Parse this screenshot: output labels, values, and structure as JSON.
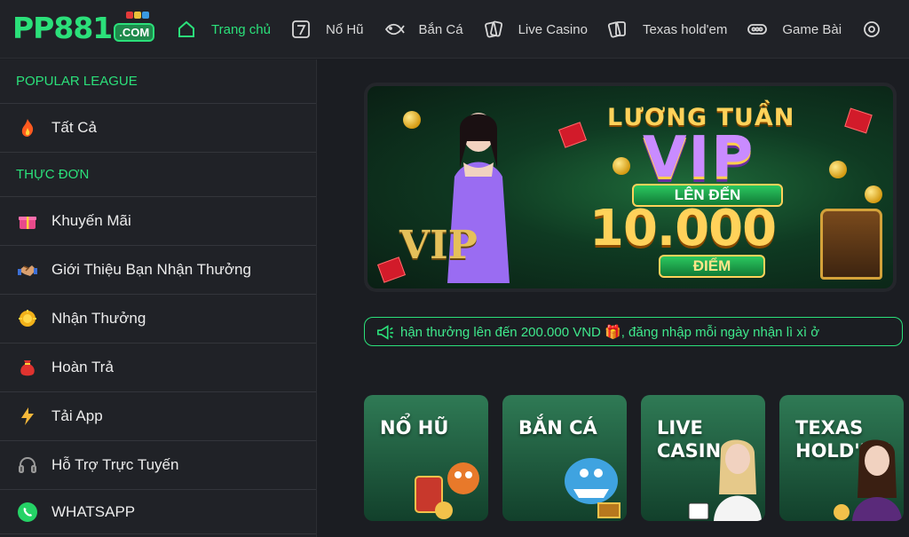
{
  "logo": {
    "main": "PP881",
    "suffix": ".COM"
  },
  "nav": [
    {
      "label": "Trang chủ",
      "icon": "home-icon",
      "active": true
    },
    {
      "label": "Nổ Hũ",
      "icon": "slot-seven-icon"
    },
    {
      "label": "Bắn Cá",
      "icon": "fish-icon"
    },
    {
      "label": "Live Casino",
      "icon": "cards-icon"
    },
    {
      "label": "Texas hold'em",
      "icon": "poker-cards-icon"
    },
    {
      "label": "Game Bài",
      "icon": "chips-icon"
    }
  ],
  "sidebar": {
    "popular_heading": "POPULAR LEAGUE",
    "popular_items": [
      {
        "label": "Tất Cả",
        "icon": "flame-icon"
      }
    ],
    "menu_heading": "THỰC ĐƠN",
    "menu_items": [
      {
        "label": "Khuyến Mãi",
        "icon": "gift-icon"
      },
      {
        "label": "Giới Thiệu Bạn Nhận Thưởng",
        "icon": "handshake-icon"
      },
      {
        "label": "Nhận Thưởng",
        "icon": "coin-burst-icon"
      },
      {
        "label": "Hoàn Trả",
        "icon": "money-bag-icon"
      },
      {
        "label": "Tải App",
        "icon": "lightning-icon"
      },
      {
        "label": "Hỗ Trợ Trực Tuyến",
        "icon": "headset-icon"
      },
      {
        "label": "WHATSAPP",
        "icon": "whatsapp-icon"
      }
    ]
  },
  "banner": {
    "title": "LƯƠNG TUẦN",
    "vip": "VIP",
    "sub": "LÊN ĐẾN",
    "amount": "10.000",
    "unit": "ĐIỂM",
    "badge": "VIP"
  },
  "ticker": {
    "text": "hận thưởng lên đến 200.000 VND 🎁, đăng nhập mỗi ngày nhận lì xì ở"
  },
  "categories": [
    {
      "label": "NỔ HŨ"
    },
    {
      "label": "BẮN CÁ"
    },
    {
      "label": "LIVE\nCASINO"
    },
    {
      "label": "TEXAS\nHOLD'EM"
    }
  ],
  "colors": {
    "accent": "#2be07a",
    "background": "#1b1d22",
    "panel": "#202227"
  }
}
